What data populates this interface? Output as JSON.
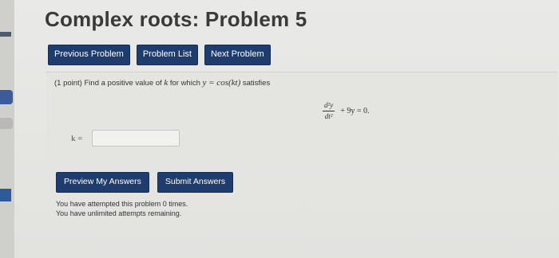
{
  "title": "Complex roots: Problem 5",
  "nav": {
    "previous": "Previous Problem",
    "list": "Problem List",
    "next": "Next Problem"
  },
  "problem": {
    "points": "(1 point)",
    "prompt_a": "Find a positive value of",
    "var_k": "k",
    "prompt_b": "for which",
    "func": "y = cos(kt)",
    "prompt_c": "satisfies",
    "eq_num": "d²y",
    "eq_den": "dt²",
    "eq_rest": "+ 9y = 0.",
    "answer_label": "k =",
    "answer_value": ""
  },
  "actions": {
    "preview": "Preview My Answers",
    "submit": "Submit Answers"
  },
  "attempts": {
    "line1": "You have attempted this problem 0 times.",
    "line2": "You have unlimited attempts remaining."
  },
  "colors": {
    "button": "#1f3c6e",
    "title": "#3a3a3a"
  }
}
